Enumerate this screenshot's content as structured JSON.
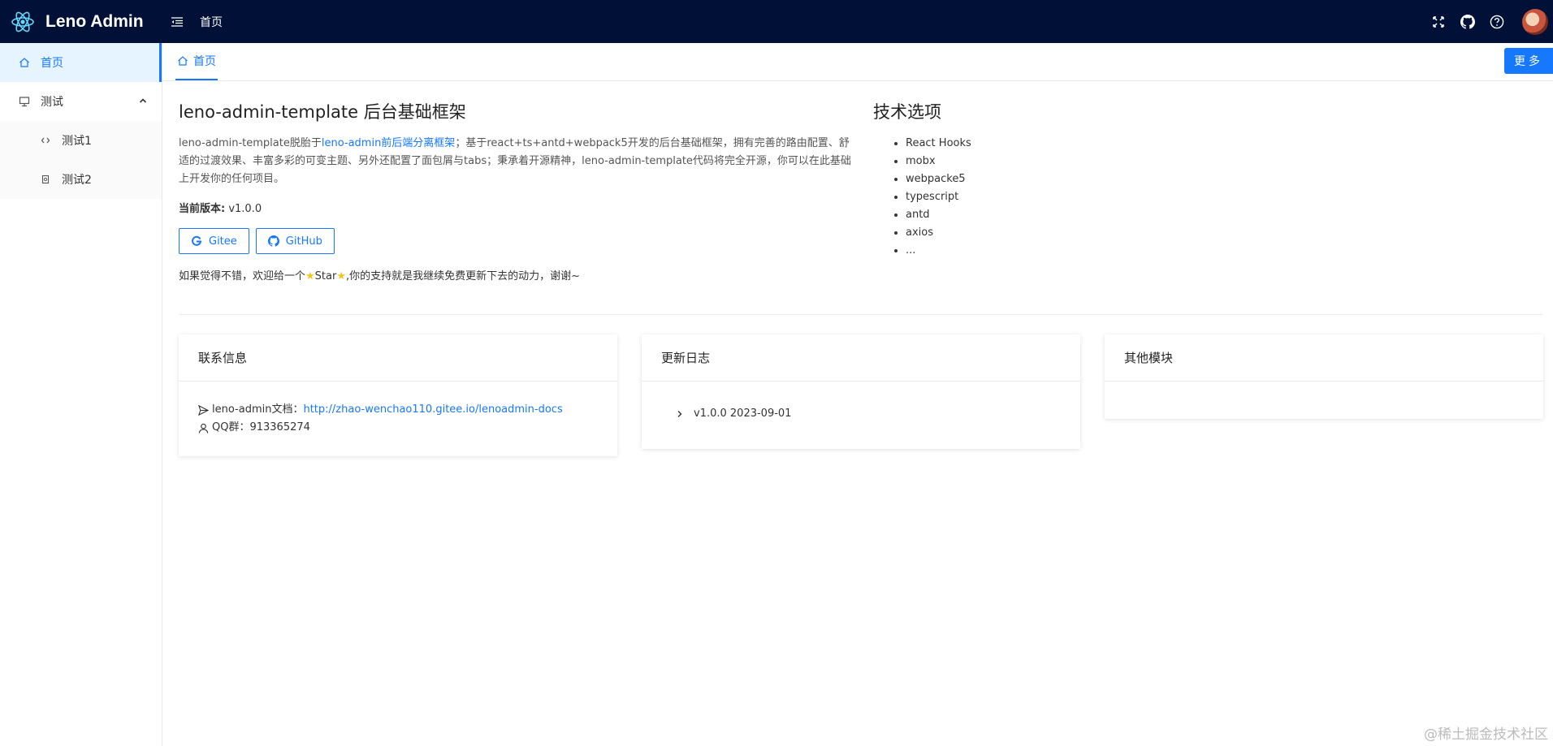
{
  "header": {
    "brand": "Leno Admin",
    "breadcrumb": "首页"
  },
  "sidebar": {
    "items": [
      {
        "label": "首页"
      },
      {
        "label": "测试"
      }
    ],
    "sub_items": [
      {
        "label": "测试1"
      },
      {
        "label": "测试2"
      }
    ]
  },
  "tabs": {
    "active": "首页",
    "more_label": "更多"
  },
  "intro": {
    "title": "leno-admin-template 后台基础框架",
    "desc_part1": "leno-admin-template脱胎于",
    "desc_link": "leno-admin前后端分离框架",
    "desc_part2": "；基于react+ts+antd+webpack5开发的后台基础框架，拥有完善的路由配置、舒适的过渡效果、丰富多彩的可变主题、另外还配置了面包屑与tabs；秉承着开源精神，leno-admin-template代码将完全开源，你可以在此基础上开发你的任何项目。",
    "version_label": "当前版本:",
    "version_value": " v1.0.0",
    "gitee_label": "Gitee",
    "github_label": "GitHub",
    "star_prefix": "如果觉得不错，欢迎给一个",
    "star_word": "Star",
    "star_suffix": ",你的支持就是我继续免费更新下去的动力，谢谢~"
  },
  "tech": {
    "title": "技术选项",
    "items": [
      "React Hooks",
      "mobx",
      "webpacke5",
      "typescript",
      "antd",
      "axios",
      "..."
    ]
  },
  "cards": {
    "contact": {
      "title": "联系信息",
      "doc_label": "leno-admin文档：",
      "doc_link": "http://zhao-wenchao110.gitee.io/lenoadmin-docs",
      "qq_label": "QQ群：",
      "qq_value": "913365274"
    },
    "changelog": {
      "title": "更新日志",
      "entry": "v1.0.0 2023-09-01"
    },
    "other": {
      "title": "其他模块"
    }
  },
  "watermark": "@稀土掘金技术社区",
  "colors": {
    "header_bg": "#001036",
    "accent": "#1677ff"
  }
}
